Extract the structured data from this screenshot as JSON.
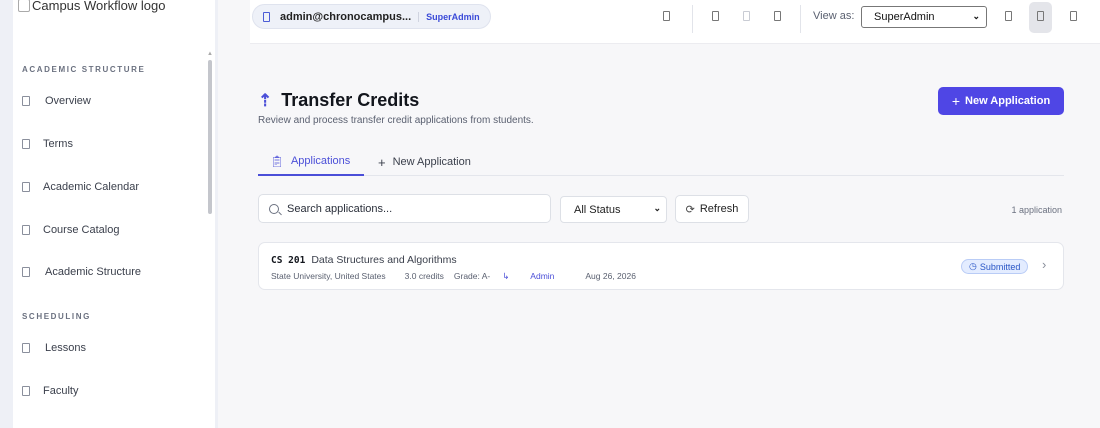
{
  "sidebar": {
    "logo_alt": "Campus Workflow logo",
    "sections": [
      {
        "label": "ACADEMIC STRUCTURE",
        "items": [
          {
            "label": "Overview",
            "icon": "overview-icon"
          },
          {
            "label": "Terms",
            "icon": "terms-icon"
          },
          {
            "label": "Academic Calendar",
            "icon": "calendar-icon"
          },
          {
            "label": "Course Catalog",
            "icon": "book-icon"
          },
          {
            "label": "Academic Structure",
            "icon": "structure-icon"
          }
        ]
      },
      {
        "label": "SCHEDULING",
        "items": [
          {
            "label": "Lessons",
            "icon": "lessons-icon"
          },
          {
            "label": "Faculty",
            "icon": "faculty-icon"
          }
        ]
      }
    ]
  },
  "topbar": {
    "user_email": "admin@chronocampus...",
    "user_role": "SuperAdmin",
    "view_as_label": "View as:",
    "view_as_value": "SuperAdmin"
  },
  "page": {
    "title": "Transfer Credits",
    "subtitle": "Review and process transfer credit applications from students.",
    "new_button": "New Application"
  },
  "tabs": [
    {
      "label": "Applications",
      "icon": "clipboard-icon",
      "active": true
    },
    {
      "label": "New Application",
      "icon": "plus-icon",
      "active": false
    }
  ],
  "filters": {
    "search_placeholder": "Search applications...",
    "status_value": "All Status",
    "refresh_label": "Refresh",
    "count_text": "1 application"
  },
  "applications": [
    {
      "code": "CS 201",
      "name": "Data Structures and Algorithms",
      "institution": "State University, United States",
      "credits": "3.0 credits",
      "grade": "Grade: A-",
      "submitted_by": "Admin",
      "date": "Aug 26, 2026",
      "status": "Submitted"
    }
  ],
  "colors": {
    "accent": "#4f46e5",
    "status_submitted_bg": "#e3ecff",
    "status_submitted_text": "#2a56c6"
  }
}
